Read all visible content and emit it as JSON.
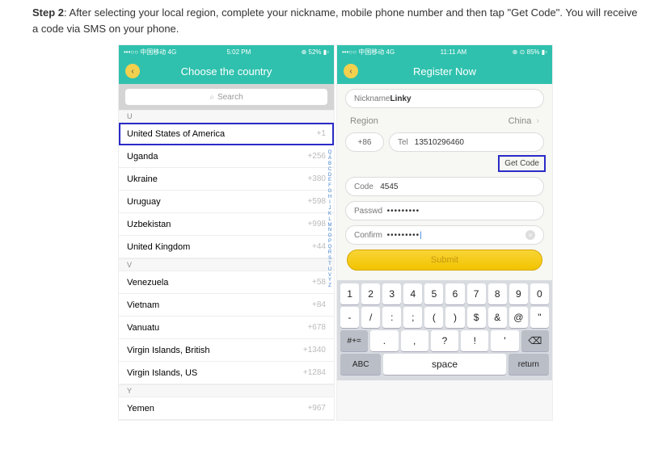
{
  "step_label": "Step 2",
  "step_text": ": After selecting your local region, complete your nickname, mobile phone number and then tap \"Get Code\". You will receive a code via SMS on your phone.",
  "left": {
    "status": {
      "carrier": "•••○○ 中国移动 4G",
      "time": "5:02 PM",
      "battery": "⊕ 52% ▮▫"
    },
    "title": "Choose the country",
    "search": "Search",
    "section_u": "U",
    "countries_u": [
      {
        "name": "United States of America",
        "code": "+1",
        "hl": true
      },
      {
        "name": "Uganda",
        "code": "+256"
      },
      {
        "name": "Ukraine",
        "code": "+380"
      },
      {
        "name": "Uruguay",
        "code": "+598"
      },
      {
        "name": "Uzbekistan",
        "code": "+998"
      },
      {
        "name": "United Kingdom",
        "code": "+44"
      }
    ],
    "section_v": "V",
    "countries_v": [
      {
        "name": "Venezuela",
        "code": "+58"
      },
      {
        "name": "Vietnam",
        "code": "+84"
      },
      {
        "name": "Vanuatu",
        "code": "+678"
      },
      {
        "name": "Virgin Islands, British",
        "code": "+1340"
      },
      {
        "name": "Virgin Islands, US",
        "code": "+1284"
      }
    ],
    "section_y": "Y",
    "countries_y": [
      {
        "name": "Yemen",
        "code": "+967"
      }
    ],
    "index": "Q A B C D E F G H I J K L M N O P Q R S T U V Y Z"
  },
  "right": {
    "status": {
      "carrier": "•••○○ 中国移动 4G",
      "time": "11:11 AM",
      "battery": "⊕ ⊙ 85% ▮▫"
    },
    "title": "Register Now",
    "nickname_label": "Nickname",
    "nickname_value": "Linky",
    "region_label": "Region",
    "region_value": "China",
    "cc": "+86",
    "tel_label": "Tel",
    "tel_value": "13510296460",
    "getcode": "Get Code",
    "code_label": "Code",
    "code_value": "4545",
    "passwd_label": "Passwd",
    "passwd_value": "•••••••••",
    "confirm_label": "Confirm",
    "confirm_value": "•••••••••",
    "submit": "Submit",
    "kb_row1": [
      "1",
      "2",
      "3",
      "4",
      "5",
      "6",
      "7",
      "8",
      "9",
      "0"
    ],
    "kb_row2": [
      "-",
      "/",
      ":",
      ";",
      "(",
      ")",
      "$",
      "&",
      "@",
      "\""
    ],
    "kb_row3": [
      "#+=",
      ".",
      ",",
      "?",
      "!",
      "'",
      "⌫"
    ],
    "kb_row4": [
      "ABC",
      "space",
      "return"
    ]
  }
}
